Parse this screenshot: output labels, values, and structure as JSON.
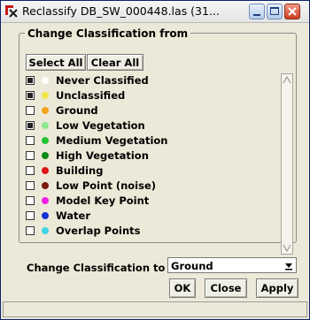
{
  "window": {
    "title": "Reclassify DB_SW_000448.las (31..."
  },
  "group": {
    "legend": "Change Classification from",
    "select_all_label": "Select All",
    "clear_all_label": "Clear All"
  },
  "classes": [
    {
      "label": "Never Classified",
      "checked": true,
      "color": "#ffffff"
    },
    {
      "label": "Unclassified",
      "checked": true,
      "color": "#f1e64a"
    },
    {
      "label": "Ground",
      "checked": false,
      "color": "#f2a41f"
    },
    {
      "label": "Low Vegetation",
      "checked": true,
      "color": "#8ee88e"
    },
    {
      "label": "Medium Vegetation",
      "checked": false,
      "color": "#22c432"
    },
    {
      "label": "High Vegetation",
      "checked": false,
      "color": "#0c8c14"
    },
    {
      "label": "Building",
      "checked": false,
      "color": "#dc1414"
    },
    {
      "label": "Low Point (noise)",
      "checked": false,
      "color": "#7a1a12"
    },
    {
      "label": "Model Key Point",
      "checked": false,
      "color": "#f01ee6"
    },
    {
      "label": "Water",
      "checked": false,
      "color": "#1432d2"
    },
    {
      "label": "Overlap Points",
      "checked": false,
      "color": "#3ed6e6"
    }
  ],
  "target": {
    "label": "Change Classification to",
    "value": "Ground"
  },
  "buttons": {
    "ok": "OK",
    "close": "Close",
    "apply": "Apply"
  }
}
